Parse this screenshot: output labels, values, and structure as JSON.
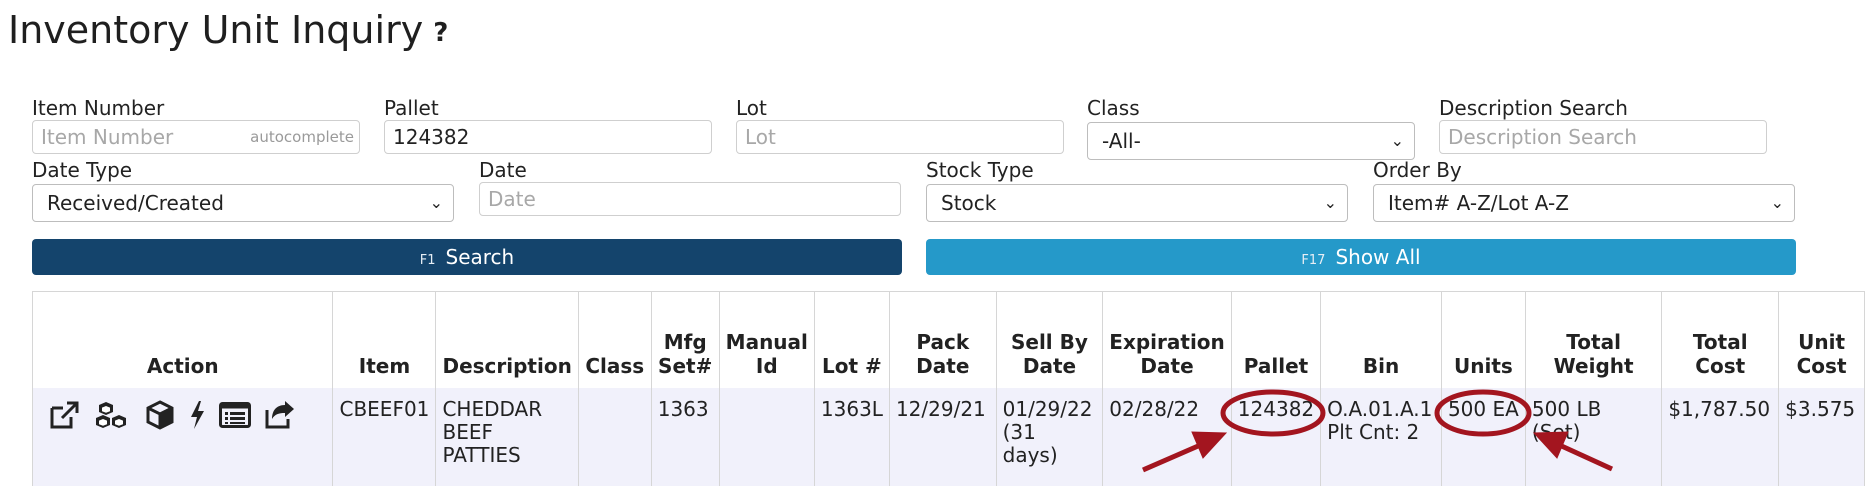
{
  "header": {
    "title": "Inventory Unit Inquiry",
    "help": "?"
  },
  "filters": {
    "item_number": {
      "label": "Item Number",
      "placeholder": "Item Number",
      "value": "",
      "hint": "autocomplete"
    },
    "pallet": {
      "label": "Pallet",
      "placeholder": "Pallet",
      "value": "124382"
    },
    "lot": {
      "label": "Lot",
      "placeholder": "Lot",
      "value": ""
    },
    "class": {
      "label": "Class",
      "value": "-All-"
    },
    "description_search": {
      "label": "Description Search",
      "placeholder": "Description Search",
      "value": ""
    },
    "date_type": {
      "label": "Date Type",
      "value": "Received/Created"
    },
    "date": {
      "label": "Date",
      "placeholder": "Date",
      "value": ""
    },
    "stock_type": {
      "label": "Stock Type",
      "value": "Stock"
    },
    "order_by": {
      "label": "Order By",
      "value": "Item# A-Z/Lot A-Z"
    }
  },
  "buttons": {
    "search": {
      "fkey": "F1",
      "label": "Search"
    },
    "show_all": {
      "fkey": "F17",
      "label": "Show All"
    }
  },
  "table": {
    "headers": {
      "action": "Action",
      "item": "Item",
      "description": "Description",
      "class": "Class",
      "mfg_set_1": "Mfg",
      "mfg_set_2": "Set#",
      "manual_id_1": "Manual",
      "manual_id_2": "Id",
      "lot": "Lot #",
      "pack_date_1": "Pack",
      "pack_date_2": "Date",
      "sell_by_1": "Sell By",
      "sell_by_2": "Date",
      "expiration_1": "Expiration",
      "expiration_2": "Date",
      "pallet": "Pallet",
      "bin": "Bin",
      "units": "Units",
      "total_weight_1": "Total",
      "total_weight_2": "Weight",
      "total_cost_1": "Total",
      "total_cost_2": "Cost",
      "unit_cost_1": "Unit",
      "unit_cost_2": "Cost"
    },
    "rows": [
      {
        "item": "CBEEF01",
        "description": "CHEDDAR BEEF PATTIES",
        "class": "",
        "mfg_set": "1363",
        "manual_id": "",
        "lot": "1363L",
        "pack_date": "12/29/21",
        "sell_by_date": "01/29/22 (31 days)",
        "expiration_date": "02/28/22",
        "pallet": "124382",
        "bin": "O.A.01.A.1",
        "bin_count": "Plt Cnt: 2",
        "units": "500 EA",
        "total_weight": "500 LB (Set)",
        "total_cost": "$1,787.50",
        "unit_cost": "$3.575",
        "actions": [
          "external-link-icon",
          "boxes-icon",
          "box-icon",
          "lightning-icon",
          "list-icon",
          "share-icon"
        ]
      }
    ]
  },
  "colors": {
    "primary": "#14446c",
    "secondary": "#2599c9",
    "annotation": "#a3151f",
    "row_bg": "#f1f1fb"
  }
}
